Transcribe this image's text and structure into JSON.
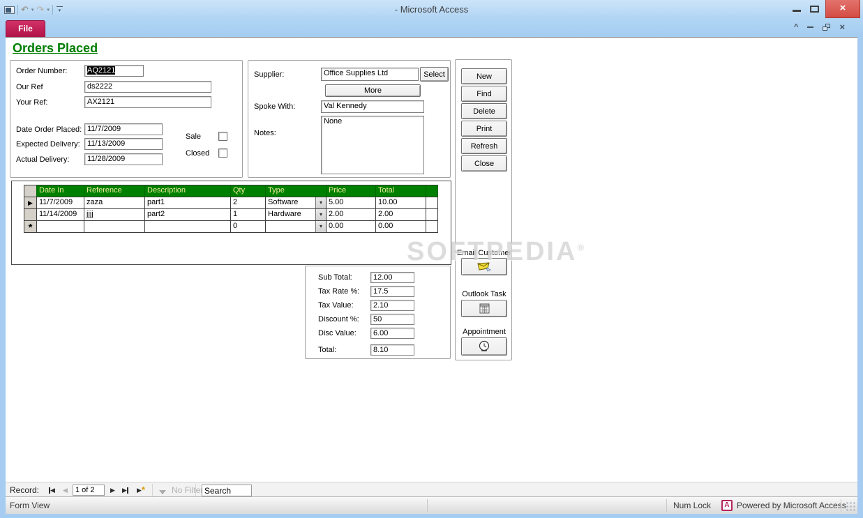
{
  "colors": {
    "titlebar_blue": "#aed3f2",
    "file_tab_pink": "#c22558",
    "close_button_red": "#d9544e",
    "heading_green": "#007d00",
    "grid_header_green": "#008000",
    "grid_header_text": "#efec9d",
    "watermark_gray": "#bdbdbd"
  },
  "icons": {
    "undo": "↶",
    "redo": "↷",
    "dropdown_arrow": "▾",
    "qat_customize": "▾",
    "win_close": "×",
    "ribbon_collapse": "^",
    "child_close": "×",
    "nav_first": "◀",
    "nav_prev": "◀",
    "nav_next": "▶",
    "nav_last": "▶",
    "nav_new": "▶",
    "nav_new_star": "*",
    "row_current": "▶",
    "row_new": "*",
    "type_dropdown": "▾"
  },
  "window": {
    "title": "- Microsoft Access",
    "file_tab": "File"
  },
  "form": {
    "heading": "Orders Placed",
    "left_fields": [
      {
        "label": "Order Number:",
        "value": "AQ2121"
      },
      {
        "label": "Our Ref",
        "value": "ds2222"
      },
      {
        "label": "Your Ref:",
        "value": "AX2121"
      },
      {
        "label": "Date Order Placed:",
        "value": "11/7/2009"
      },
      {
        "label": "Expected Delivery:",
        "value": "11/13/2009"
      },
      {
        "label": "Actual Delivery:",
        "value": "11/28/2009"
      }
    ],
    "checkboxes": [
      {
        "label": "Sale",
        "checked": false
      },
      {
        "label": "Closed",
        "checked": false
      }
    ],
    "supplier": {
      "label": "Supplier:",
      "value": "Office Supplies Ltd",
      "select_button": "Select",
      "more_button": "More",
      "spoke_with_label": "Spoke With:",
      "spoke_with_value": "Val Kennedy",
      "notes_label": "Notes:",
      "notes_value": "None"
    },
    "actions": [
      "New",
      "Find",
      "Delete",
      "Print",
      "Refresh",
      "Close"
    ],
    "tools": [
      {
        "label": "Email Customer",
        "icon": "email-icon"
      },
      {
        "label": "Outlook Task",
        "icon": "task-icon"
      },
      {
        "label": "Appointment",
        "icon": "clock-icon"
      }
    ],
    "table": {
      "columns": [
        "Date In",
        "Reference",
        "Description",
        "Qty",
        "Type",
        "Price",
        "Total"
      ],
      "rows": [
        {
          "date_in": "11/7/2009",
          "reference": "zaza",
          "description": "part1",
          "qty": "2",
          "type": "Software",
          "price": "5.00",
          "total": "10.00"
        },
        {
          "date_in": "11/14/2009",
          "reference": "jjjj",
          "description": "part2",
          "qty": "1",
          "type": "Hardware",
          "price": "2.00",
          "total": "2.00"
        },
        {
          "date_in": "",
          "reference": "",
          "description": "",
          "qty": "0",
          "type": "",
          "price": "0.00",
          "total": "0.00"
        }
      ]
    },
    "totals": [
      {
        "label": "Sub Total:",
        "value": "12.00"
      },
      {
        "label": "Tax Rate %:",
        "value": "17.5"
      },
      {
        "label": "Tax Value:",
        "value": "2.10"
      },
      {
        "label": "Discount %:",
        "value": "50"
      },
      {
        "label": "Disc Value:",
        "value": "6.00"
      },
      {
        "label": "Total:",
        "value": "8.10"
      }
    ]
  },
  "record_nav": {
    "label": "Record:",
    "position": "1 of 2",
    "no_filter": "No Filter",
    "search": "Search"
  },
  "status_bar": {
    "view": "Form View",
    "num_lock": "Num Lock",
    "access_letter": "A",
    "powered": "Powered by Microsoft Access"
  },
  "watermark": {
    "text": "SOFTPEDIA",
    "reg": "®"
  }
}
